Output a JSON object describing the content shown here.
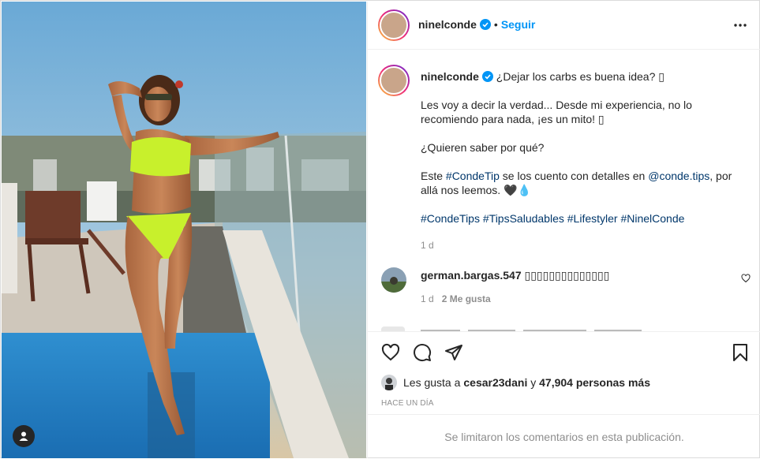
{
  "colors": {
    "accent": "#0095f6",
    "hashtag": "#00376b",
    "muted": "#8e8e8e",
    "text": "#262626"
  },
  "header": {
    "username": "ninelconde",
    "separator": "•",
    "follow_label": "Seguir",
    "more_icon": "more-horizontal-icon"
  },
  "caption": {
    "username": "ninelconde",
    "first_line": "¿Dejar los carbs es buena idea? ▯",
    "para1": "Les voy a decir la verdad... Desde mi experiencia, no lo recomiendo para nada, ¡es un mito! ▯",
    "para2": "¿Quieren saber por qué?",
    "para3_prefix": "Este ",
    "para3_tag": "#CondeTip",
    "para3_mid": " se los cuento con detalles en ",
    "para3_mention": "@conde.tips",
    "para3_suffix": ", por allá nos leemos. 🖤💧",
    "hashtags": [
      "#CondeTips",
      "#TipsSaludables",
      "#Lifestyler",
      "#NinelConde"
    ],
    "age": "1 d"
  },
  "comment": {
    "username": "german.bargas.547",
    "text": "▯▯▯▯▯▯▯▯▯▯▯▯▯▯",
    "age": "1 d",
    "likes": "2 Me gusta"
  },
  "likes": {
    "prefix": "Les gusta a ",
    "user": "cesar23dani",
    "mid": " y ",
    "count": "47,904 personas más"
  },
  "timestamp": "HACE UN DÍA",
  "comments_limited": "Se limitaron los comentarios en esta publicación."
}
